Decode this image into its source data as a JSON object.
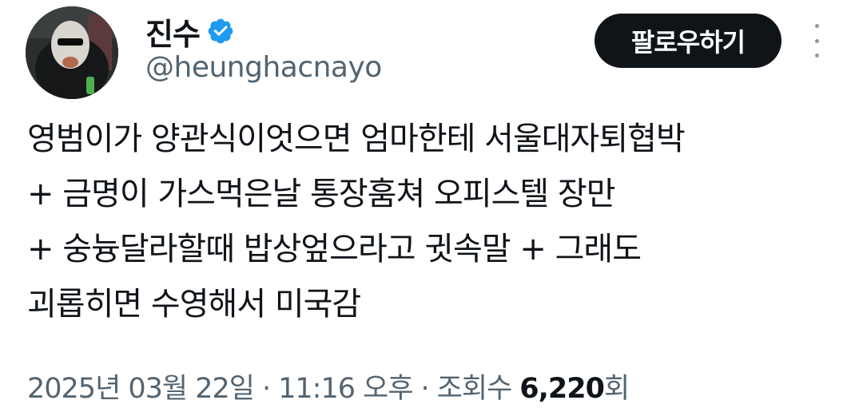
{
  "author": {
    "display_name": "진수",
    "handle": "@heunghacnayo",
    "verified": true,
    "verified_color": "#1d9bf0"
  },
  "actions": {
    "follow_label": "팔로우하기",
    "more_icon": "more-vertical-icon"
  },
  "tweet": {
    "lines": [
      "영범이가 양관식이엇으면 엄마한테 서울대자퇴협박",
      "+ 금명이 가스먹은날 통장훔쳐 오피스텔 장만",
      "+ 숭늉달라할때 밥상엎으라고 귓속말 + 그래도",
      "괴롭히면 수영해서 미국감"
    ]
  },
  "meta": {
    "date": "2025년 03월 22일",
    "separator": "·",
    "time": "11:16 오후",
    "views_label": "조회수",
    "views_count": "6,220",
    "views_suffix": "회"
  }
}
